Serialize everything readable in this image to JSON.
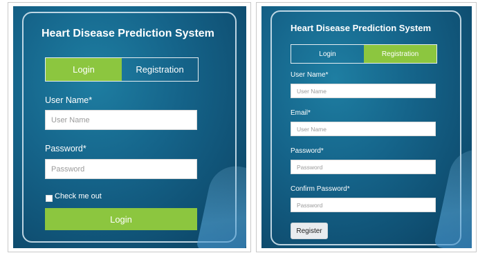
{
  "login_screen": {
    "title": "Heart Disease Prediction System",
    "tabs": [
      {
        "label": "Login",
        "active": true
      },
      {
        "label": "Registration",
        "active": false
      }
    ],
    "username": {
      "label": "User Name*",
      "placeholder": "User Name"
    },
    "password": {
      "label": "Password*",
      "placeholder": "Password"
    },
    "remember": {
      "label": "Check me out",
      "checked": false
    },
    "submit_label": "Login"
  },
  "registration_screen": {
    "title": "Heart Disease Prediction System",
    "tabs": [
      {
        "label": "Login",
        "active": false
      },
      {
        "label": "Registration",
        "active": true
      }
    ],
    "username": {
      "label": "User Name*",
      "placeholder": "User Name"
    },
    "email": {
      "label": "Email*",
      "placeholder": "User Name"
    },
    "password": {
      "label": "Password*",
      "placeholder": "Password"
    },
    "confirm_password": {
      "label": "Confirm Password*",
      "placeholder": "Password"
    },
    "submit_label": "Register"
  },
  "colors": {
    "accent_green": "#8cc63f",
    "background_teal": "#15648a",
    "text_white": "#ffffff"
  }
}
